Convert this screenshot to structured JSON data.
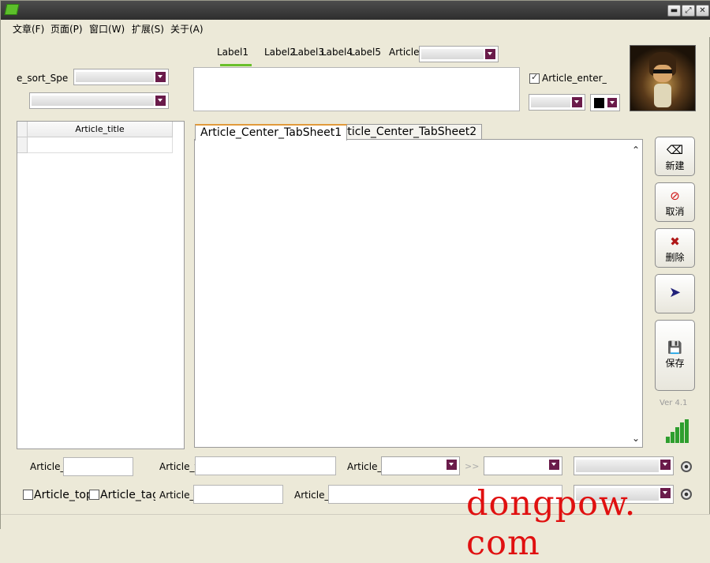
{
  "titlebar": {
    "buttons": [
      "minimize",
      "restore",
      "close"
    ]
  },
  "menu": [
    "文章(F)",
    "页面(P)",
    "窗口(W)",
    "扩展(S)",
    "关于(A)"
  ],
  "top_tabs": [
    "Label1",
    "Label2",
    "Label3",
    "Label4",
    "Label5"
  ],
  "top_tabs_active": 0,
  "article_field_label": "Article_",
  "sort_label": "e_sort_Spe",
  "enter_checkbox": {
    "label": "Article_enter_(",
    "checked": true
  },
  "color_swatch": "#000000",
  "grid": {
    "column_header": "Article_title"
  },
  "center_tabs": [
    "Article_Center_TabSheet1",
    "Article_Center_TabSheet2"
  ],
  "center_tabs_active": 0,
  "side_buttons": [
    {
      "icon": "eraser-icon",
      "label": "新建"
    },
    {
      "icon": "cancel-icon",
      "label": "取消"
    },
    {
      "icon": "delete-icon",
      "label": "删除"
    },
    {
      "icon": "arrow-right-icon",
      "label": ""
    },
    {
      "icon": "save-icon",
      "label": "保存"
    }
  ],
  "version": "Ver 4.1",
  "bottom_row1": {
    "label1": "Article_p",
    "label2": "Article_t",
    "label3": "Article_s",
    "range_sep": ">>"
  },
  "bottom_row2": {
    "top_checkbox": "Article_top",
    "tag_checkbox": "Article_tag_",
    "label_a": "Article_a",
    "label_s": "Article_s"
  },
  "watermark": "dongpow. com",
  "accent_color": "#6abf2b"
}
